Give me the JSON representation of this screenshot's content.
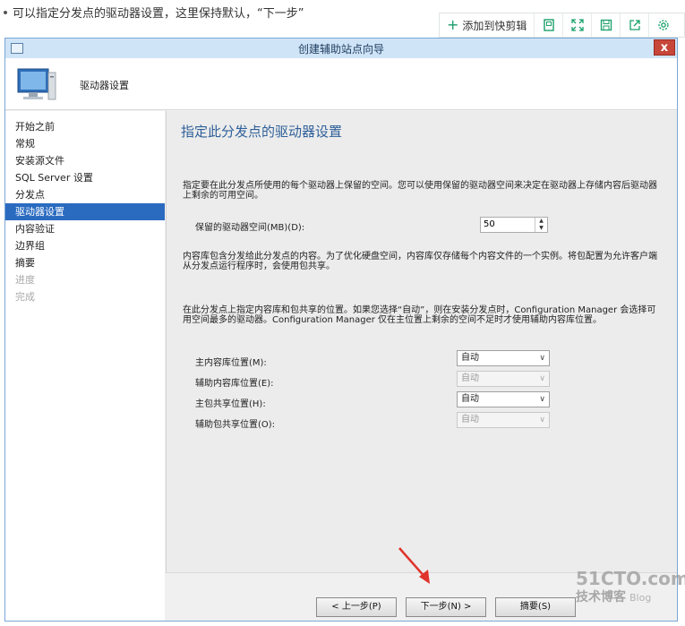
{
  "caption": {
    "text": "可以指定分发点的驱动器设置，这里保持默认，“下一步”"
  },
  "blog_toolbar": {
    "add_label": "添加到快剪辑",
    "icons": [
      "square-icon",
      "expand-icon",
      "save-icon",
      "share-icon",
      "settings-icon"
    ]
  },
  "window": {
    "title": "创建辅助站点向导",
    "close_label": "x",
    "header_title": "驱动器设置"
  },
  "nav": {
    "items": [
      {
        "label": "开始之前",
        "state": "normal"
      },
      {
        "label": "常规",
        "state": "normal"
      },
      {
        "label": "安装源文件",
        "state": "normal"
      },
      {
        "label": "SQL Server 设置",
        "state": "normal"
      },
      {
        "label": "分发点",
        "state": "normal"
      },
      {
        "label": "驱动器设置",
        "state": "active"
      },
      {
        "label": "内容验证",
        "state": "normal"
      },
      {
        "label": "边界组",
        "state": "normal"
      },
      {
        "label": "摘要",
        "state": "normal"
      },
      {
        "label": "进度",
        "state": "disabled"
      },
      {
        "label": "完成",
        "state": "disabled"
      }
    ]
  },
  "content": {
    "title": "指定此分发点的驱动器设置",
    "intro": "指定要在此分发点所使用的每个驱动器上保留的空间。您可以使用保留的驱动器空间来决定在驱动器上存储内容后驱动器上剩余的可用空间。",
    "reserved_label": "保留的驱动器空间(MB)(D):",
    "reserved_value": "50",
    "library_note": "内容库包含分发给此分发点的内容。为了优化硬盘空间，内容库仅存储每个内容文件的一个实例。将包配置为允许客户端从分发点运行程序时，会使用包共享。",
    "location_note": "在此分发点上指定内容库和包共享的位置。如果您选择“自动”，则在安装分发点时，Configuration Manager 会选择可用空间最多的驱动器。Configuration Manager 仅在主位置上剩余的空间不足时才使用辅助内容库位置。",
    "locations": [
      {
        "label": "主内容库位置(M):",
        "value": "自动",
        "enabled": true
      },
      {
        "label": "辅助内容库位置(E):",
        "value": "自动",
        "enabled": false
      },
      {
        "label": "主包共享位置(H):",
        "value": "自动",
        "enabled": true
      },
      {
        "label": "辅助包共享位置(O):",
        "value": "自动",
        "enabled": false
      }
    ]
  },
  "footer": {
    "prev_label": "< 上一步(P)",
    "next_label": "下一步(N) >",
    "summary_label": "摘要(S)"
  },
  "watermark": {
    "line1": "51CTO.com",
    "line2": "技术博客",
    "line3": "Blog"
  },
  "colors": {
    "accent": "#2a6bc0",
    "title_blue": "#2e5f99",
    "arrow_red": "#e0332b"
  }
}
